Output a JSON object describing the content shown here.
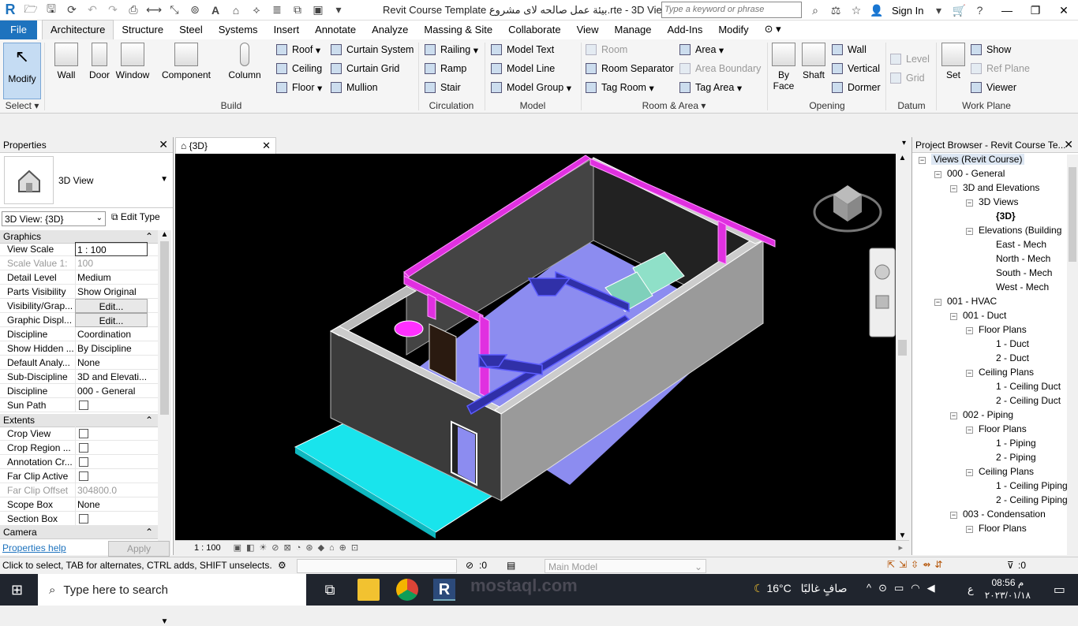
{
  "titlebar": {
    "title": "Revit Course Template بيئة عمل صالحه لاى مشروع.rte - 3D Vie...",
    "search_placeholder": "Type a keyword or phrase",
    "sign_in": "Sign In"
  },
  "tabs": [
    "File",
    "Architecture",
    "Structure",
    "Steel",
    "Systems",
    "Insert",
    "Annotate",
    "Analyze",
    "Massing & Site",
    "Collaborate",
    "View",
    "Manage",
    "Add-Ins",
    "Modify"
  ],
  "ribbon": {
    "select": {
      "modify": "Modify",
      "label": "Select"
    },
    "build": {
      "label": "Build",
      "wall": "Wall",
      "door": "Door",
      "window": "Window",
      "component": "Component",
      "column": "Column",
      "roof": "Roof",
      "ceiling": "Ceiling",
      "floor": "Floor",
      "curtain_system": "Curtain System",
      "curtain_grid": "Curtain Grid",
      "mullion": "Mullion"
    },
    "circulation": {
      "label": "Circulation",
      "railing": "Railing",
      "ramp": "Ramp",
      "stair": "Stair"
    },
    "model": {
      "label": "Model",
      "model_text": "Model Text",
      "model_line": "Model Line",
      "model_group": "Model Group"
    },
    "room": {
      "label": "Room & Area",
      "room": "Room",
      "room_separator": "Room Separator",
      "tag_room": "Tag Room",
      "area": "Area",
      "area_boundary": "Area Boundary",
      "tag_area": "Tag Area"
    },
    "opening": {
      "label": "Opening",
      "by_face": "By Face",
      "shaft": "Shaft",
      "wall": "Wall",
      "vertical": "Vertical",
      "dormer": "Dormer"
    },
    "datum": {
      "label": "Datum",
      "level": "Level",
      "grid": "Grid"
    },
    "workplane": {
      "label": "Work Plane",
      "set": "Set",
      "show": "Show",
      "ref_plane": "Ref Plane",
      "viewer": "Viewer"
    }
  },
  "properties": {
    "title": "Properties",
    "type_name": "3D View",
    "selector": "3D View: {3D}",
    "edit_type": "Edit Type",
    "sections": {
      "graphics": "Graphics",
      "extents": "Extents",
      "camera": "Camera"
    },
    "graphics_rows": [
      {
        "k": "View Scale",
        "v": "1 : 100"
      },
      {
        "k": "Scale Value    1:",
        "v": "100"
      },
      {
        "k": "Detail Level",
        "v": "Medium"
      },
      {
        "k": "Parts Visibility",
        "v": "Show Original"
      },
      {
        "k": "Visibility/Grap...",
        "v": "Edit..."
      },
      {
        "k": "Graphic Displ...",
        "v": "Edit..."
      },
      {
        "k": "Discipline",
        "v": "Coordination"
      },
      {
        "k": "Show Hidden ...",
        "v": "By Discipline"
      },
      {
        "k": "Default Analy...",
        "v": "None"
      },
      {
        "k": "Sub-Discipline",
        "v": "3D and Elevati..."
      },
      {
        "k": "Discipline",
        "v": "000 - General"
      },
      {
        "k": "Sun Path",
        "v": ""
      }
    ],
    "extents_rows": [
      {
        "k": "Crop View",
        "v": ""
      },
      {
        "k": "Crop Region ...",
        "v": ""
      },
      {
        "k": "Annotation Cr...",
        "v": ""
      },
      {
        "k": "Far Clip Active",
        "v": ""
      },
      {
        "k": "Far Clip Offset",
        "v": "304800.0"
      },
      {
        "k": "Scope Box",
        "v": "None"
      },
      {
        "k": "Section Box",
        "v": ""
      }
    ],
    "help": "Properties help",
    "apply": "Apply"
  },
  "view": {
    "tab": "{3D}",
    "scale": "1 : 100"
  },
  "browser": {
    "title": "Project Browser - Revit Course Te...",
    "nodes": [
      "Views (Revit Course)",
      "000 - General",
      "3D and Elevations",
      "3D Views",
      "{3D}",
      "Elevations (Building",
      "East - Mech",
      "North - Mech",
      "South - Mech",
      "West - Mech",
      "001 - HVAC",
      "001 - Duct",
      "Floor Plans",
      "1 - Duct",
      "2 - Duct",
      "Ceiling Plans",
      "1 - Ceiling Duct",
      "2 - Ceiling Duct",
      "002 - Piping",
      "Floor Plans",
      "1 - Piping",
      "2 - Piping",
      "Ceiling Plans",
      "1 - Ceiling Piping",
      "2 - Ceiling Piping",
      "003 - Condensation",
      "Floor Plans"
    ]
  },
  "status": {
    "hint": "Click to select, TAB for alternates, CTRL adds, SHIFT unselects.",
    "count": ":0",
    "model": "Main Model",
    "filter": ":0"
  },
  "taskbar": {
    "search": "Type here to search",
    "temp": "16°C",
    "weather": "صافٍ غالبًا",
    "time": "08:56 م",
    "date": "٢٠٢٣/٠١/١٨",
    "lang": "ع"
  },
  "watermark": "mostaql.com"
}
